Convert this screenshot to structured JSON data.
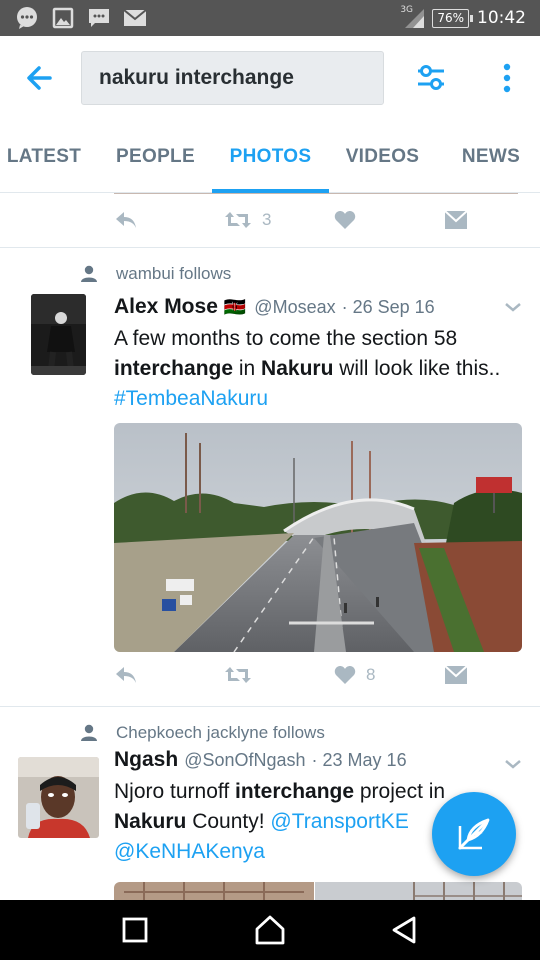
{
  "status_bar": {
    "network": "3G",
    "battery": "76%",
    "time": "10:42",
    "icons": [
      "chat-icon",
      "gallery-icon",
      "message-icon",
      "mail-icon",
      "signal-icon",
      "battery-icon"
    ]
  },
  "topbar": {
    "search_query": "nakuru interchange",
    "icons": [
      "back-arrow-icon",
      "filter-icon",
      "more-vert-icon"
    ]
  },
  "tabs": [
    {
      "label": "LATEST",
      "active": false
    },
    {
      "label": "PEOPLE",
      "active": false
    },
    {
      "label": "PHOTOS",
      "active": true
    },
    {
      "label": "VIDEOS",
      "active": false
    },
    {
      "label": "NEWS",
      "active": false
    }
  ],
  "prev_tweet": {
    "retweets": "3",
    "likes": ""
  },
  "tweets": [
    {
      "social_context": "wambui follows",
      "name": "Alex Mose",
      "flag": "🇰🇪",
      "handle": "@Moseax",
      "date": "· 26 Sep 16",
      "text": {
        "part1": "A few months to come the section 58 ",
        "bold1": "interchange",
        "part2": " in ",
        "bold2": "Nakuru",
        "part3": " will look like this..",
        "hashtag": "#TembeaNakuru"
      },
      "retweets": "",
      "likes": "8"
    },
    {
      "social_context": "Chepkoech jacklyne follows",
      "name": "Ngash",
      "handle": "@SonOfNgash",
      "date": "· 23 May 16",
      "text": {
        "part1": "Njoro turnoff ",
        "bold1": "interchange",
        "part2": " project in",
        "bold2": "Nakuru",
        "part3": " County! ",
        "mention1": "@TransportKE",
        "mention2": "@KeNHAKenya"
      }
    }
  ],
  "colors": {
    "accent": "#1da1f2",
    "muted": "#657786",
    "icon_gray": "#aab8c2",
    "status_bar": "#555555"
  }
}
